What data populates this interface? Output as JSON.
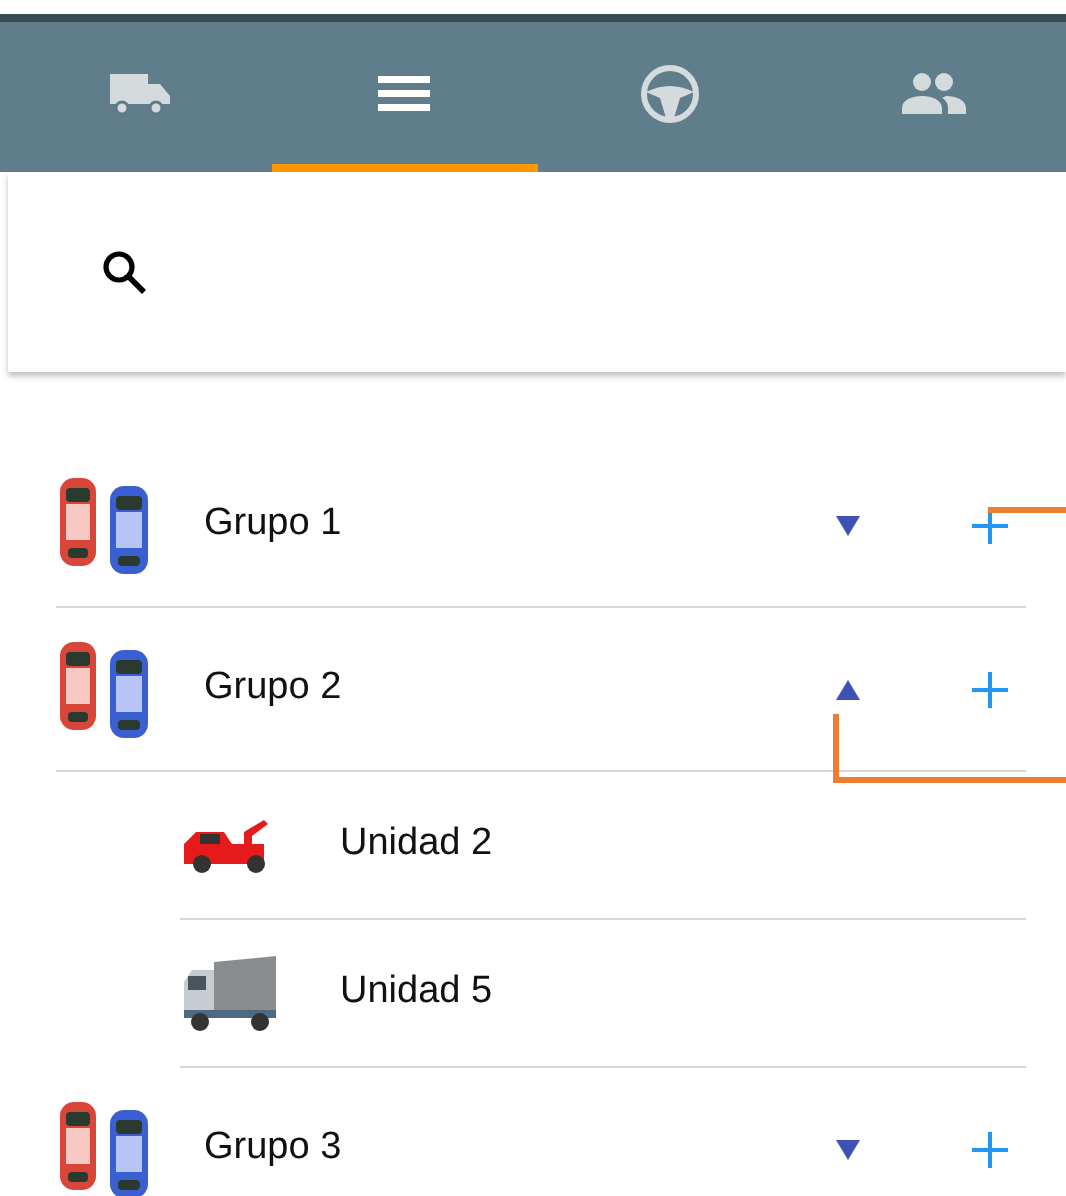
{
  "tabs": [
    {
      "kind": "truck",
      "selected": false
    },
    {
      "kind": "list",
      "selected": true
    },
    {
      "kind": "steering-wheel",
      "selected": false
    },
    {
      "kind": "people",
      "selected": false
    }
  ],
  "groups": [
    {
      "name": "Grupo 1",
      "expanded": false
    },
    {
      "name": "Grupo 2",
      "expanded": true,
      "units": [
        {
          "name": "Unidad 2",
          "kind": "tow-truck"
        },
        {
          "name": "Unidad 5",
          "kind": "box-truck"
        }
      ]
    },
    {
      "name": "Grupo 3",
      "expanded": false
    }
  ]
}
